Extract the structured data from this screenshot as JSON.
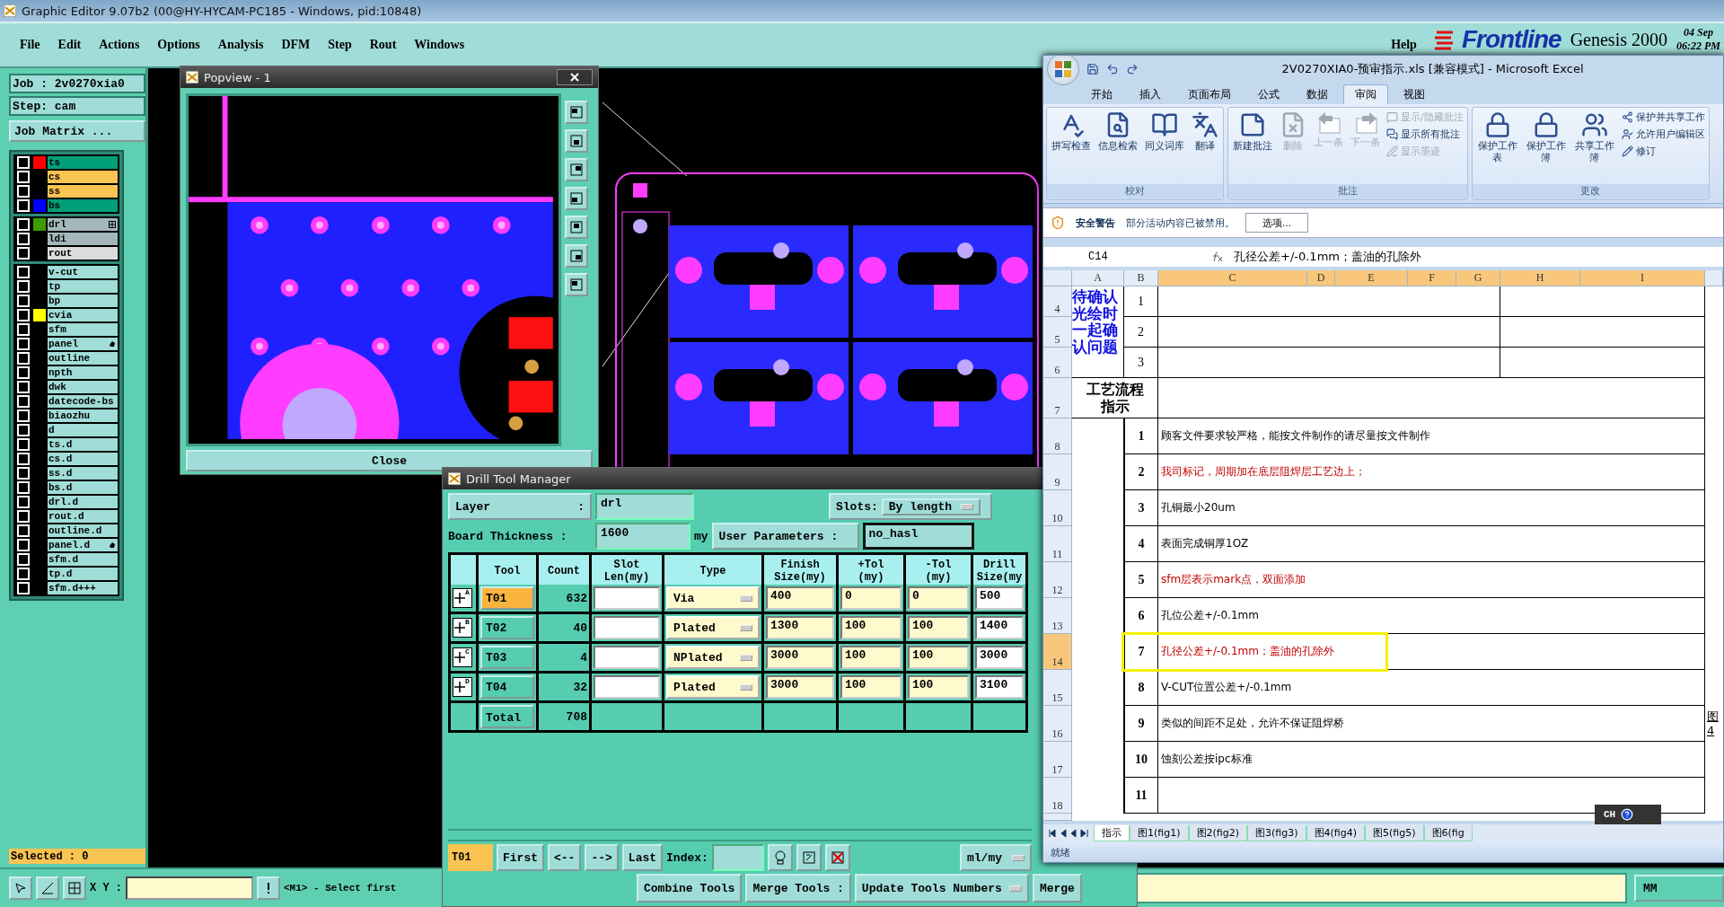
{
  "editor": {
    "title": "Graphic Editor 9.07b2 (00@HY-HYCAM-PC185 - Windows, pid:10848)",
    "menu": [
      "File",
      "Edit",
      "Actions",
      "Options",
      "Analysis",
      "DFM",
      "Step",
      "Rout",
      "Windows"
    ],
    "help": "Help",
    "logo": "Frontline",
    "product": "Genesis 2000",
    "date": "04 Sep",
    "time": "06:22 PM",
    "job": "Job : 2v0270xia0",
    "step": "Step: cam",
    "job_matrix": "Job Matrix ...",
    "layer_groups": [
      {
        "layers": [
          {
            "name": "ts",
            "checked": false,
            "kind": "board",
            "color": "#ff0000"
          },
          {
            "name": "cs",
            "checked": false,
            "kind": "mask"
          },
          {
            "name": "ss",
            "checked": false,
            "kind": "mask"
          },
          {
            "name": "bs",
            "checked": false,
            "kind": "board",
            "color": "#0000ff"
          }
        ]
      },
      {
        "layers": [
          {
            "name": "drl",
            "checked": false,
            "kind": "drill",
            "color": "#3c9c00",
            "marked": true
          },
          {
            "name": "ldi",
            "checked": false,
            "kind": "drill"
          },
          {
            "name": "rout",
            "checked": false,
            "kind": "rout"
          }
        ]
      },
      {
        "layers": [
          {
            "name": "v-cut",
            "checked": false,
            "kind": "doc"
          },
          {
            "name": "tp",
            "checked": false,
            "kind": "doc"
          },
          {
            "name": "bp",
            "checked": false,
            "kind": "doc"
          },
          {
            "name": "cvia",
            "checked": false,
            "kind": "doc",
            "color": "#ffff00"
          },
          {
            "name": "sfm",
            "checked": false,
            "kind": "doc"
          },
          {
            "name": "panel",
            "checked": false,
            "kind": "doc",
            "marked": true
          },
          {
            "name": "outline",
            "checked": false,
            "kind": "doc"
          },
          {
            "name": "npth",
            "checked": false,
            "kind": "doc"
          },
          {
            "name": "dwk",
            "checked": false,
            "kind": "doc"
          },
          {
            "name": "datecode-bs",
            "checked": false,
            "kind": "doc"
          },
          {
            "name": "biaozhu",
            "checked": false,
            "kind": "doc"
          },
          {
            "name": "d",
            "checked": false,
            "kind": "doc"
          },
          {
            "name": "ts.d",
            "checked": false,
            "kind": "doc"
          },
          {
            "name": "cs.d",
            "checked": false,
            "kind": "doc"
          },
          {
            "name": "ss.d",
            "checked": false,
            "kind": "doc"
          },
          {
            "name": "bs.d",
            "checked": false,
            "kind": "doc"
          },
          {
            "name": "drl.d",
            "checked": false,
            "kind": "doc"
          },
          {
            "name": "rout.d",
            "checked": false,
            "kind": "doc"
          },
          {
            "name": "outline.d",
            "checked": false,
            "kind": "doc"
          },
          {
            "name": "panel.d",
            "checked": false,
            "kind": "doc",
            "marked": true
          },
          {
            "name": "sfm.d",
            "checked": false,
            "kind": "doc"
          },
          {
            "name": "tp.d",
            "checked": false,
            "kind": "doc"
          },
          {
            "name": "sfm.d+++",
            "checked": false,
            "kind": "doc"
          }
        ]
      }
    ],
    "selected_count": "Selected : 0",
    "xy_label": "X Y :",
    "message": "<M1> - Select first",
    "units": "MM"
  },
  "popview": {
    "title": "Popview - 1",
    "close": "Close"
  },
  "drill_manager": {
    "title": "Drill Tool Manager",
    "layer": {
      "label": "Layer",
      "colon": ":",
      "value": "drl"
    },
    "slots": {
      "label": "Slots:",
      "value": "By length"
    },
    "board_thickness": {
      "label": "Board Thickness :",
      "value": "1600",
      "unit": "my"
    },
    "user_parameters": {
      "label": "User Parameters :",
      "value": "no_hasl"
    },
    "columns": [
      "Tool",
      "Count",
      "Slot\nLen(my)",
      "Type",
      "Finish\nSize(my)",
      "+Tol\n(my)",
      "-Tol\n(my)",
      "Drill\nSize(my"
    ],
    "tools": [
      {
        "tag": "A",
        "tool": "T01",
        "selected": true,
        "count": "632",
        "type": "Via",
        "finish": "400",
        "plus_tol": "0",
        "minus_tol": "0",
        "drill": "500"
      },
      {
        "tag": "B",
        "tool": "T02",
        "selected": false,
        "count": "40",
        "type": "Plated",
        "finish": "1300",
        "plus_tol": "100",
        "minus_tol": "100",
        "drill": "1400"
      },
      {
        "tag": "C",
        "tool": "T03",
        "selected": false,
        "count": "4",
        "type": "NPlated",
        "finish": "3000",
        "plus_tol": "100",
        "minus_tol": "100",
        "drill": "3000"
      },
      {
        "tag": "D",
        "tool": "T04",
        "selected": false,
        "count": "32",
        "type": "Plated",
        "finish": "3000",
        "plus_tol": "100",
        "minus_tol": "100",
        "drill": "3100"
      }
    ],
    "total": {
      "label": "Total",
      "count": "708"
    },
    "nav": {
      "current": "T01",
      "buttons": [
        "First",
        "<--",
        "-->",
        "Last"
      ],
      "index_label": "Index:",
      "units": "ml/my"
    },
    "actions": [
      {
        "label": "Combine Tools",
        "kind": "button"
      },
      {
        "label": "Merge Tools :",
        "kind": "label"
      },
      {
        "label": "Update Tools Numbers",
        "kind": "menu"
      },
      {
        "label": "Merge",
        "kind": "button"
      }
    ]
  },
  "excel": {
    "title": "2V0270XIA0-预审指示.xls  [兼容模式] - Microsoft Excel",
    "tabs": [
      {
        "label": "开始",
        "selected": false
      },
      {
        "label": "插入",
        "selected": false
      },
      {
        "label": "页面布局",
        "selected": false
      },
      {
        "label": "公式",
        "selected": false
      },
      {
        "label": "数据",
        "selected": false
      },
      {
        "label": "审阅",
        "selected": true
      },
      {
        "label": "视图",
        "selected": false
      }
    ],
    "groups": [
      {
        "title": "校对",
        "items": [
          {
            "label": "拼写检查",
            "kind": "large",
            "disabled": false
          },
          {
            "label": "信息检索",
            "kind": "large",
            "disabled": false
          },
          {
            "label": "同义词库",
            "kind": "large",
            "disabled": false
          },
          {
            "label": "翻译",
            "kind": "large",
            "disabled": false
          }
        ]
      },
      {
        "title": "批注",
        "items": [
          {
            "label": "新建批注",
            "kind": "large",
            "disabled": false
          },
          {
            "label": "删除",
            "kind": "large",
            "disabled": true
          },
          {
            "label": "上一条",
            "kind": "large",
            "disabled": true
          },
          {
            "label": "下一条",
            "kind": "large",
            "disabled": true
          },
          {
            "label": "显示/隐藏批注",
            "kind": "small",
            "disabled": true
          },
          {
            "label": "显示所有批注",
            "kind": "small",
            "disabled": false
          },
          {
            "label": "显示墨迹",
            "kind": "small",
            "disabled": true
          }
        ]
      },
      {
        "title": "更改",
        "items": [
          {
            "label": "保护工作表",
            "kind": "large",
            "disabled": false
          },
          {
            "label": "保护工作簿",
            "kind": "large",
            "disabled": false
          },
          {
            "label": "共享工作簿",
            "kind": "large",
            "disabled": false
          },
          {
            "label": "保护并共享工作",
            "kind": "small",
            "disabled": false
          },
          {
            "label": "允许用户编辑区",
            "kind": "small",
            "disabled": false
          },
          {
            "label": "修订",
            "kind": "small",
            "disabled": false
          }
        ]
      }
    ],
    "security": {
      "title": "安全警告",
      "message": "部分活动内容已被禁用。",
      "button": "选项..."
    },
    "name_box": "C14",
    "formula": "孔径公差+/-0.1mm；盖油的孔除外",
    "columns": [
      {
        "label": "A",
        "selected": false
      },
      {
        "label": "B",
        "selected": false
      },
      {
        "label": "C",
        "selected": true
      },
      {
        "label": "D",
        "selected": true
      },
      {
        "label": "E",
        "selected": true
      },
      {
        "label": "F",
        "selected": true
      },
      {
        "label": "G",
        "selected": true
      },
      {
        "label": "H",
        "selected": true
      },
      {
        "label": "I",
        "selected": true
      }
    ],
    "rows": [
      {
        "label": "4",
        "selected": false
      },
      {
        "label": "5",
        "selected": false
      },
      {
        "label": "6",
        "selected": false
      },
      {
        "label": "7",
        "selected": false
      },
      {
        "label": "8",
        "selected": false
      },
      {
        "label": "9",
        "selected": false
      },
      {
        "label": "10",
        "selected": false
      },
      {
        "label": "11",
        "selected": false
      },
      {
        "label": "12",
        "selected": false
      },
      {
        "label": "13",
        "selected": false
      },
      {
        "label": "14",
        "selected": true
      },
      {
        "label": "15",
        "selected": false
      },
      {
        "label": "16",
        "selected": false
      },
      {
        "label": "17",
        "selected": false
      },
      {
        "label": "18",
        "selected": false
      }
    ],
    "confirm_note": "待确认光绘时一起确认问题",
    "confirm_rows": [
      "1",
      "2",
      "3"
    ],
    "section_title": "工艺流程指示",
    "instructions": [
      {
        "no": "1",
        "text": "顾客文件要求较严格，能按文件制作的请尽量按文件制作",
        "emphasized": false,
        "selected": false
      },
      {
        "no": "2",
        "text": "我司标记，周期加在底层阻焊层工艺边上；",
        "emphasized": true,
        "selected": false
      },
      {
        "no": "3",
        "text": "孔铜最小20um",
        "emphasized": false,
        "selected": false
      },
      {
        "no": "4",
        "text": "表面完成铜厚1OZ",
        "emphasized": false,
        "selected": false
      },
      {
        "no": "5",
        "text": "sfm层表示mark点，双面添加",
        "emphasized": true,
        "selected": false
      },
      {
        "no": "6",
        "text": "孔位公差+/-0.1mm",
        "emphasized": false,
        "selected": false
      },
      {
        "no": "7",
        "text": "孔径公差+/-0.1mm；盖油的孔除外",
        "emphasized": true,
        "selected": true
      },
      {
        "no": "8",
        "text": "V-CUT位置公差+/-0.1mm",
        "emphasized": false,
        "selected": false
      },
      {
        "no": "9",
        "text": "类似的间距不足处，允许不保证阻焊桥",
        "emphasized": false,
        "selected": false,
        "side_note": [
          "图",
          "4"
        ]
      },
      {
        "no": "10",
        "text": "蚀刻公差按ipc标准",
        "emphasized": false,
        "selected": false
      },
      {
        "no": "11",
        "selected": false
      }
    ],
    "sheets": [
      {
        "label": "指示",
        "selected": true
      },
      {
        "label": "图1(fig1)",
        "selected": false
      },
      {
        "label": "图2(fig2)",
        "selected": false
      },
      {
        "label": "图3(fig3)",
        "selected": false
      },
      {
        "label": "图4(fig4)",
        "selected": false
      },
      {
        "label": "图5(fig5)",
        "selected": false
      },
      {
        "label": "图6(fig",
        "selected": false
      }
    ],
    "status": "就绪",
    "ime": "CH"
  }
}
